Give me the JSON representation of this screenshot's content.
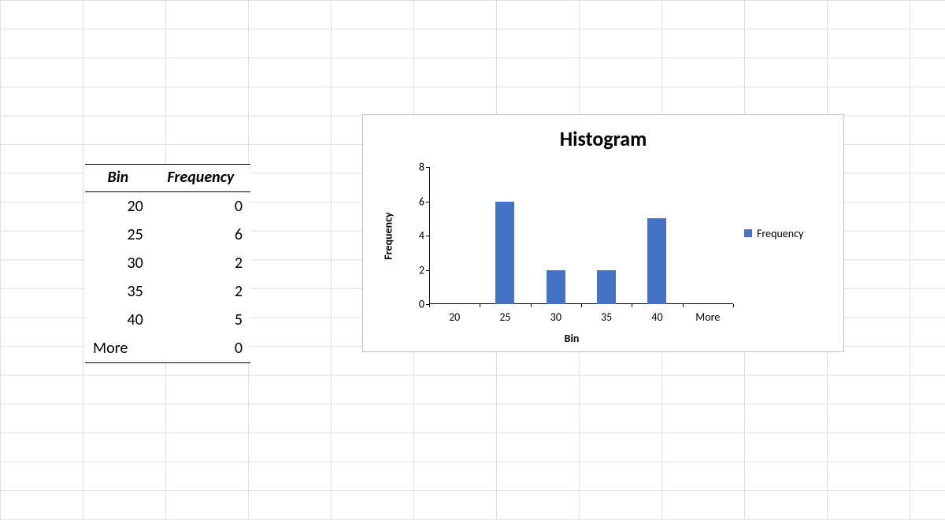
{
  "table": {
    "headers": {
      "bin": "Bin",
      "freq": "Frequency"
    },
    "rows": [
      {
        "bin": "20",
        "bin_is_text": false,
        "freq": "0"
      },
      {
        "bin": "25",
        "bin_is_text": false,
        "freq": "6"
      },
      {
        "bin": "30",
        "bin_is_text": false,
        "freq": "2"
      },
      {
        "bin": "35",
        "bin_is_text": false,
        "freq": "2"
      },
      {
        "bin": "40",
        "bin_is_text": false,
        "freq": "5"
      },
      {
        "bin": "More",
        "bin_is_text": true,
        "freq": "0"
      }
    ]
  },
  "chart": {
    "title": "Histogram",
    "xlabel": "Bin",
    "ylabel": "Frequency",
    "legend": "Frequency",
    "y_ticks": [
      "0",
      "2",
      "4",
      "6",
      "8"
    ]
  },
  "chart_data": {
    "type": "bar",
    "title": "Histogram",
    "xlabel": "Bin",
    "ylabel": "Frequency",
    "ylim": [
      0,
      8
    ],
    "categories": [
      "20",
      "25",
      "30",
      "35",
      "40",
      "More"
    ],
    "series": [
      {
        "name": "Frequency",
        "values": [
          0,
          6,
          2,
          2,
          5,
          0
        ]
      }
    ]
  },
  "colors": {
    "bar": "#4472c4"
  }
}
